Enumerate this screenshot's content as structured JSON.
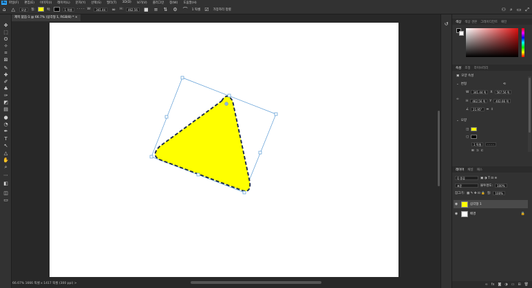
{
  "menubar": {
    "logo": "Ps",
    "items": [
      "파일(F)",
      "편집(E)",
      "이미지(I)",
      "레이어(L)",
      "문자(Y)",
      "선택(S)",
      "필터(T)",
      "3D(D)",
      "보기(V)",
      "플러그인",
      "창(W)",
      "도움말(H)"
    ]
  },
  "options": {
    "shape_mode": "모양",
    "fill_label": "칠:",
    "stroke_label": "획:",
    "stroke_width": "1 픽셀",
    "w_label": "W:",
    "w_value": "341.44",
    "h_label": "H:",
    "h_value": "462.56",
    "corner_label": "1 픽셀",
    "align_edges": "가장자리 정렬",
    "fill_color": "#ffff00",
    "stroke_color": "#000000"
  },
  "document": {
    "tab_title": "제목 없음-1 @ 66.7% (삼각형 1, RGB/8) *",
    "canvas_color": "#ffffff",
    "shape_fill": "#ffff00",
    "bbox_color": "#5b9bd5"
  },
  "status": {
    "text": "66.67%   1666 픽셀 x 1417 픽셀 (300 ppi)   >"
  },
  "panels": {
    "color_tabs": [
      "색상",
      "색상 견본",
      "그레이디언트",
      "패턴"
    ],
    "props_tabs": [
      "속성",
      "조정",
      "라이브러리"
    ],
    "props_kind": "모양 속성",
    "transform_title": "변형",
    "w_label": "W",
    "w_value": "341.44 픽",
    "x_label": "X",
    "x_value": "567.56 픽",
    "h_label": "H",
    "h_value": "462.56 픽",
    "y_label": "Y",
    "y_value": "402.66 픽",
    "angle_value": "21.95°",
    "appearance_title": "모양",
    "stroke_width_value": "1 픽셀",
    "layers_tabs": [
      "레이어",
      "채널",
      "패스"
    ],
    "layers_filter": "Q 종류",
    "blend_mode": "표준",
    "opacity_label": "불투명도:",
    "opacity_value": "100%",
    "lock_label": "잠그기:",
    "fill_label": "칠:",
    "fill_value": "100%",
    "layers": [
      {
        "name": "삼각형 1",
        "selected": true
      },
      {
        "name": "배경",
        "selected": false
      }
    ]
  }
}
